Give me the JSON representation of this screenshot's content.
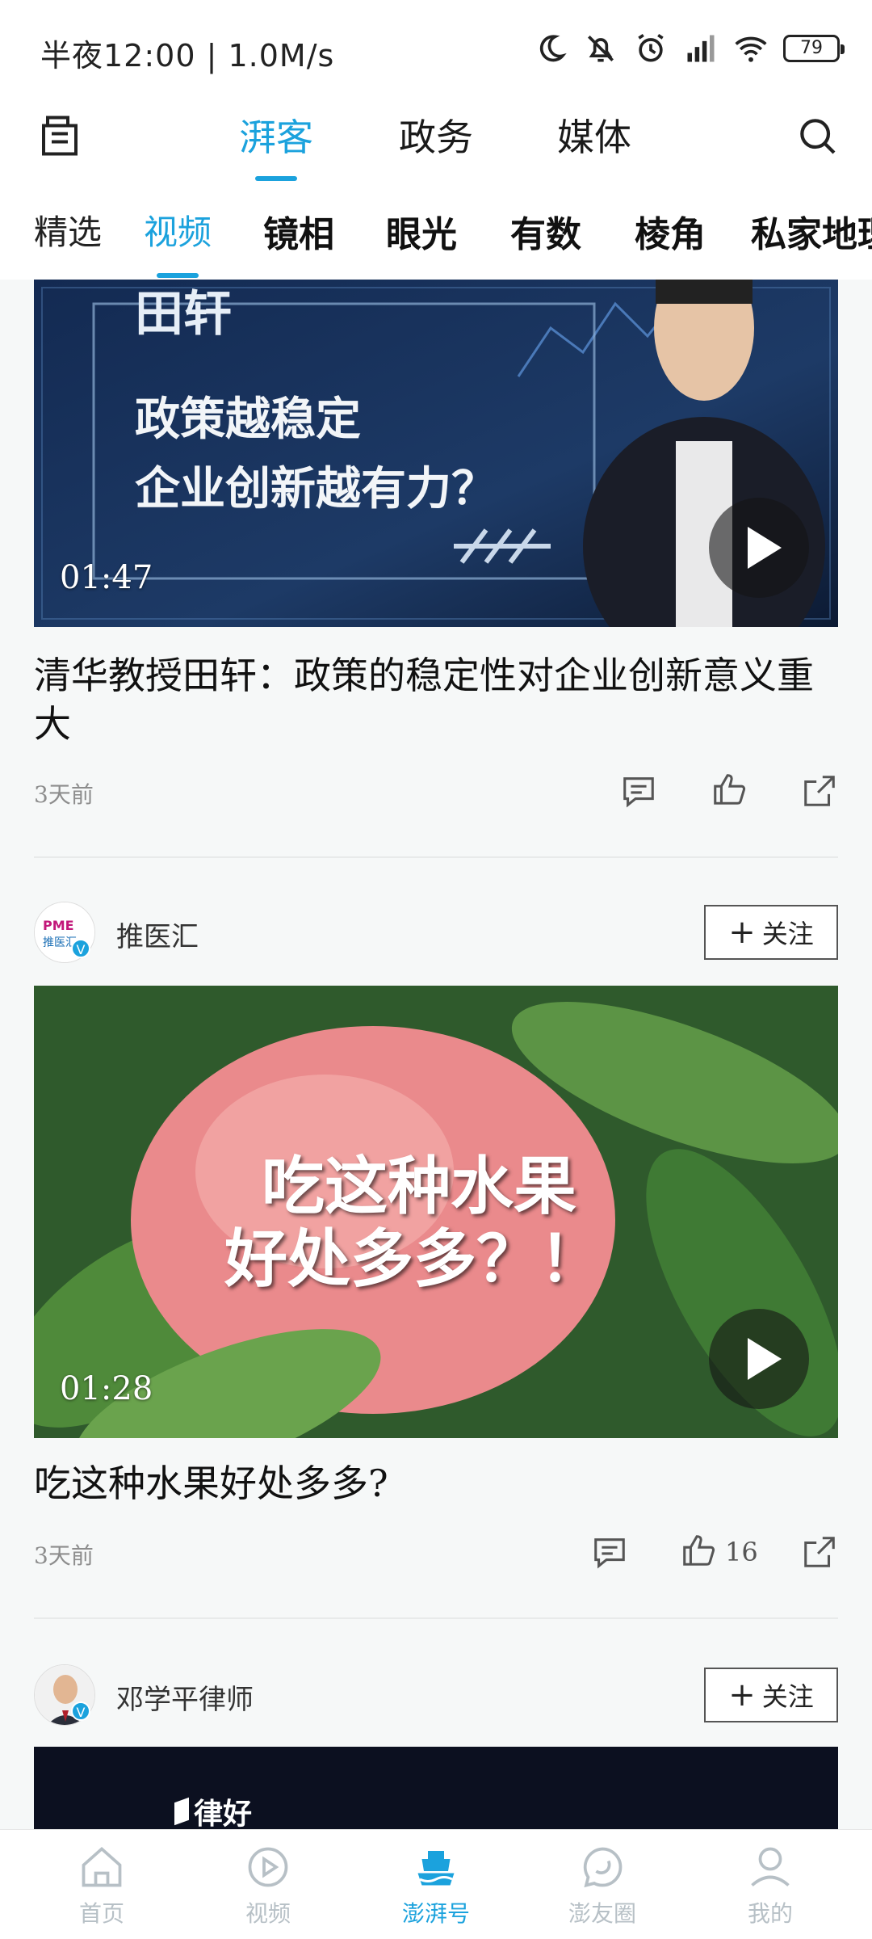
{
  "status_bar": {
    "time_speed": "半夜12:00 | 1.0M/s",
    "battery": "79"
  },
  "top_nav": {
    "tabs": [
      {
        "label": "湃客",
        "active": true
      },
      {
        "label": "政务",
        "active": false
      },
      {
        "label": "媒体",
        "active": false
      }
    ]
  },
  "sub_nav": {
    "tabs": [
      {
        "label": "精选"
      },
      {
        "label": "视频"
      },
      {
        "label": "镜相"
      },
      {
        "label": "眼光"
      },
      {
        "label": "有数"
      },
      {
        "label": "棱角"
      },
      {
        "label": "私家地理"
      }
    ],
    "active_index": 1
  },
  "feed": {
    "cards": [
      {
        "thumbnail_text": [
          "田轩",
          "政策越稳定",
          "企业创新越有力？"
        ],
        "duration": "01:47",
        "title": "清华教授田轩：政策的稳定性对企业创新意义重大",
        "time": "3天前",
        "likes": ""
      },
      {
        "author": "推医汇",
        "avatar_text": "PME 推医汇",
        "follow_label": "关注",
        "thumbnail_text": [
          "吃这种水果",
          "好处多多？！"
        ],
        "duration": "01:28",
        "title": "吃这种水果好处多多?",
        "time": "3天前",
        "likes": "16"
      },
      {
        "author": "邓学平律师",
        "follow_label": "关注",
        "thumbnail_text": [
          "律好"
        ]
      }
    ]
  },
  "bottom_nav": {
    "items": [
      {
        "label": "首页"
      },
      {
        "label": "视频"
      },
      {
        "label": "澎湃号"
      },
      {
        "label": "澎友圈"
      },
      {
        "label": "我的"
      }
    ],
    "active_index": 2
  },
  "colors": {
    "accent": "#1ba2dd",
    "icon_gray": "#b7c0c6"
  }
}
